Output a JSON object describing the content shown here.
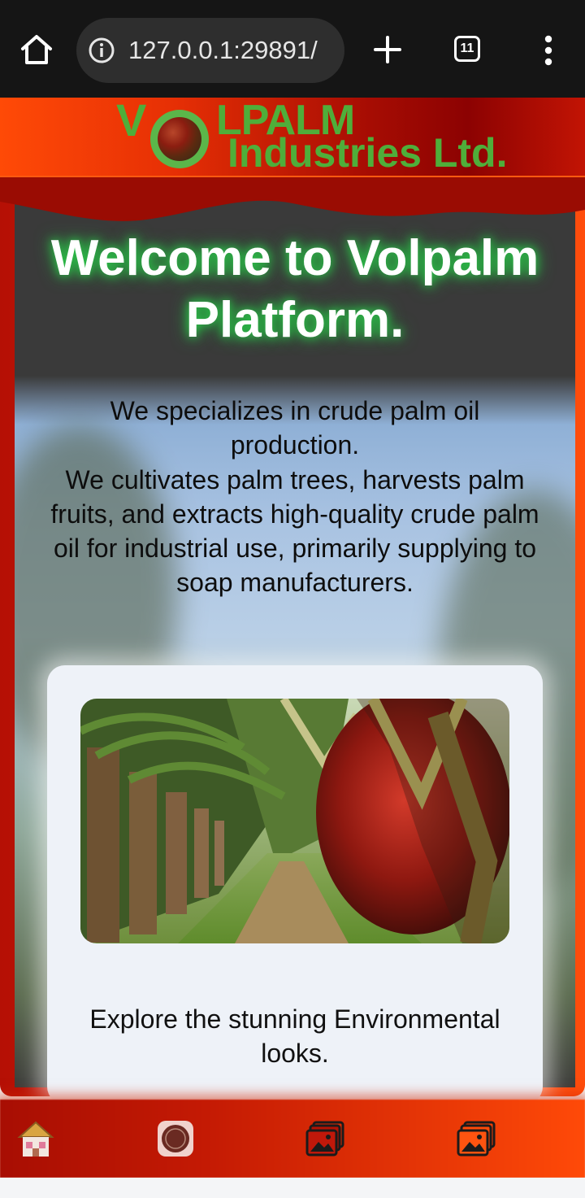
{
  "browser": {
    "url": "127.0.0.1:29891/",
    "tab_count": "11",
    "icons": [
      "home-icon",
      "info-icon",
      "plus-icon",
      "tabs-icon",
      "kebab-menu-icon"
    ]
  },
  "header": {
    "brand_initial": "V",
    "brand_rest": "LPALM",
    "brand_sub": "Industries Ltd.",
    "brand_color": "#4fae3a"
  },
  "hero": {
    "title": "Welcome to Volpalm Platform.",
    "paragraph_1": "We specializes in crude palm oil production.",
    "paragraph_2": "We cultivates palm trees, harvests palm fruits, and extracts high-quality crude palm oil for industrial use, primarily supplying to soap manufacturers."
  },
  "card": {
    "caption": "Explore the stunning Environmental looks."
  },
  "bottom_nav": {
    "items": [
      "house-icon",
      "palm-coin-icon",
      "gallery-icon",
      "gallery-icon"
    ]
  },
  "colors": {
    "accent_orange": "#ff4a06",
    "accent_red": "#8c0202",
    "glow_green": "#2ad24a"
  }
}
